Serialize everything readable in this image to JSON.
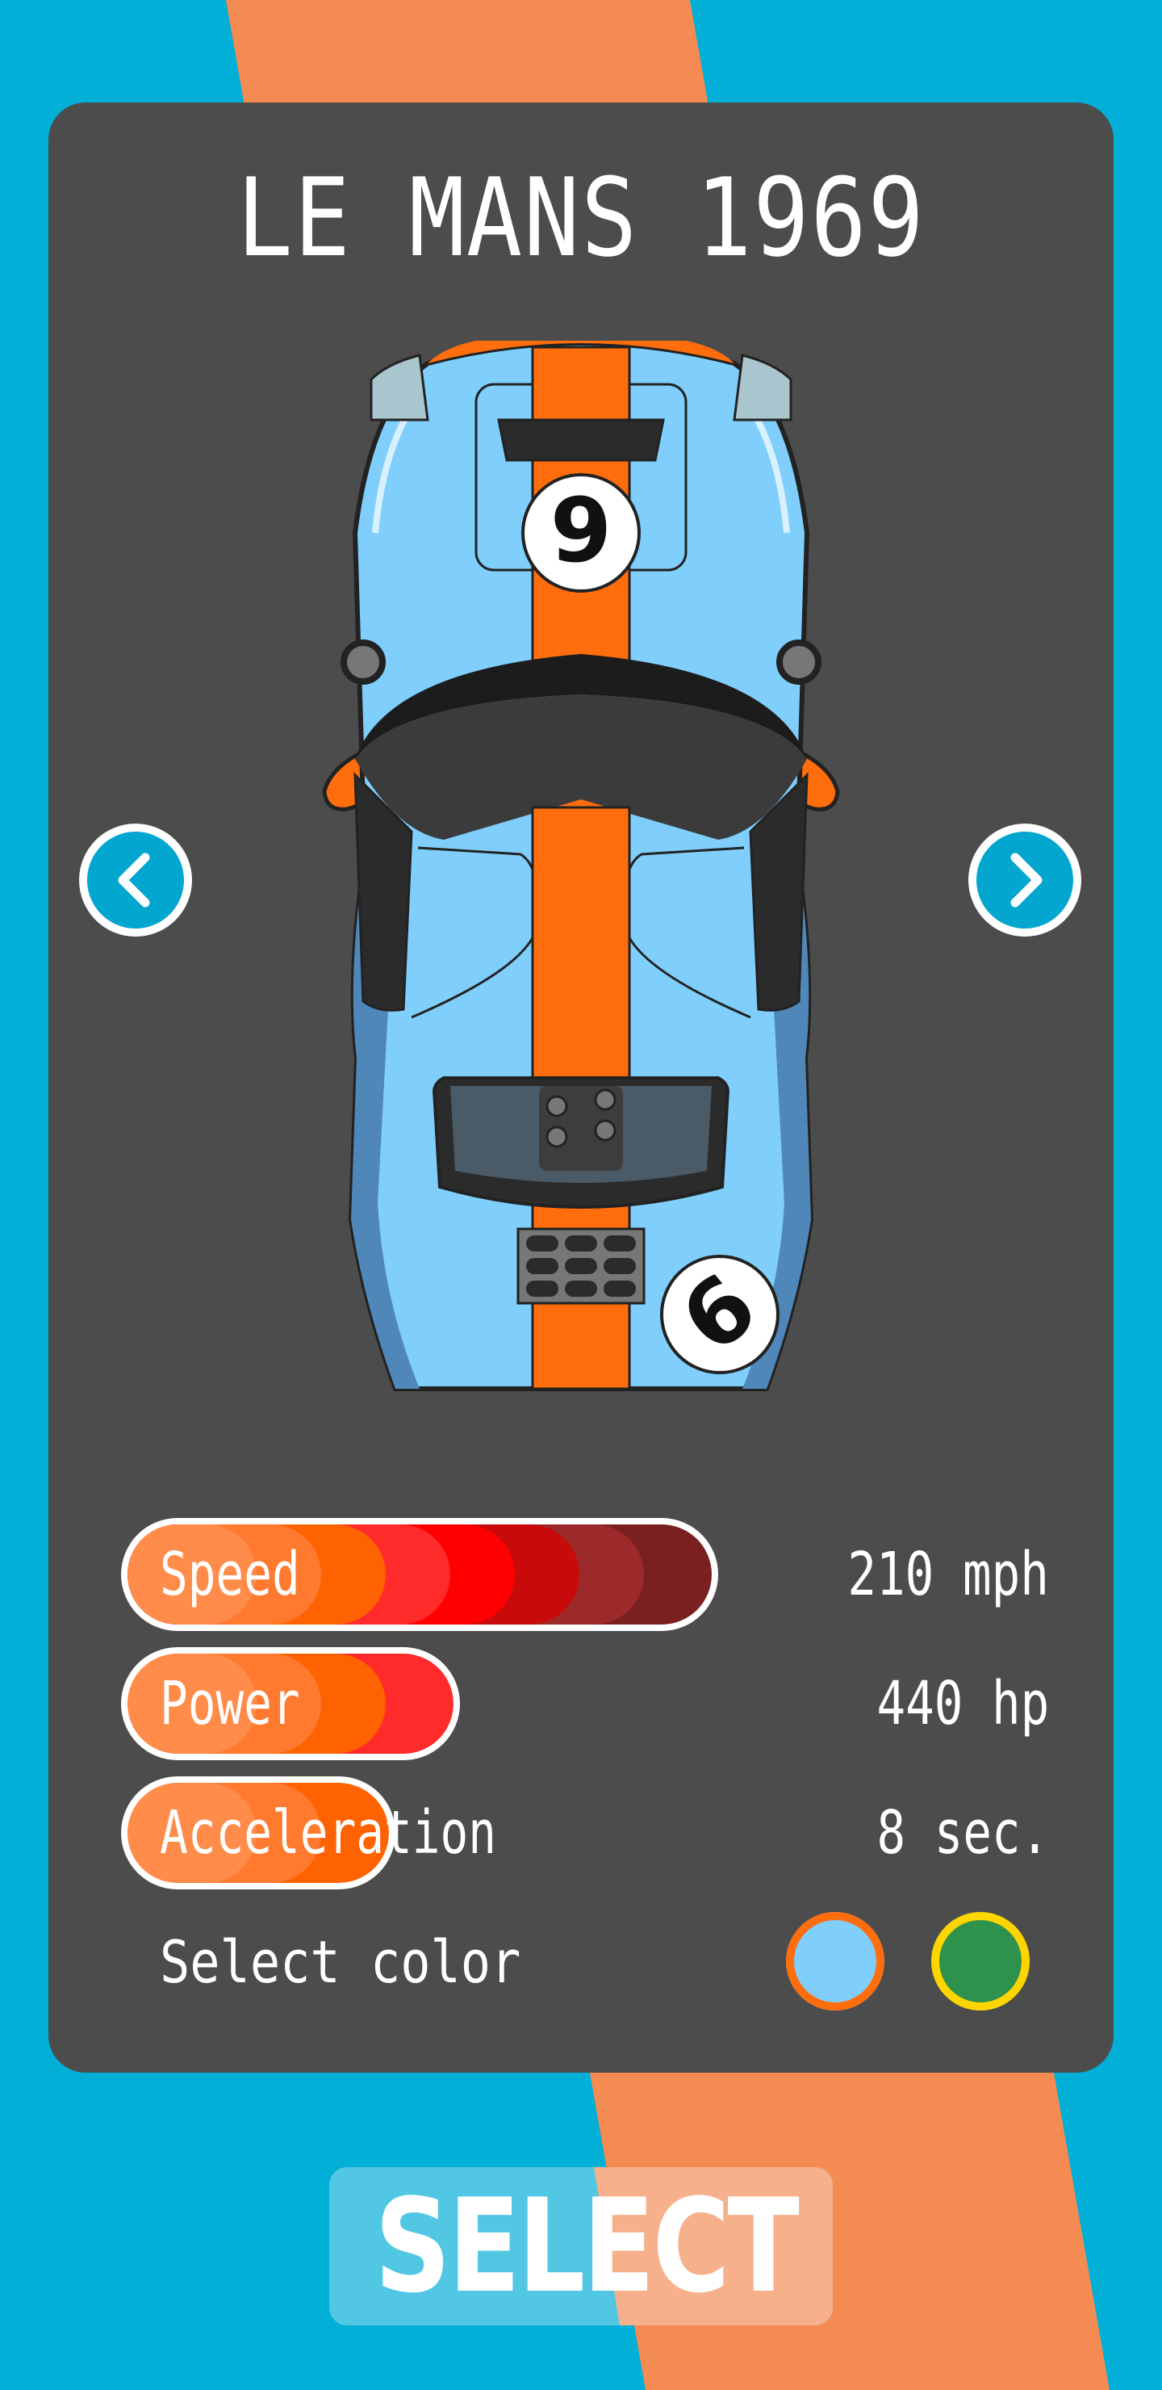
{
  "track_name": "LE MANS 1969",
  "car": {
    "livery": "gulf",
    "front_number": "9",
    "rear_number": "6",
    "colors": {
      "body": "#7fcefb",
      "stripe": "#ff6d0d",
      "shadow": "#4f87b9",
      "dark": "#2b2b2b"
    }
  },
  "navigation": {
    "prev_icon": "chevron-left-icon",
    "next_icon": "chevron-right-icon"
  },
  "stats": [
    {
      "label": "Speed",
      "value": "210 mph",
      "level": 0.82
    },
    {
      "label": "Power",
      "value": "440 hp",
      "level": 0.42
    },
    {
      "label": "Acceleration",
      "value": "8 sec.",
      "level": 0.32
    }
  ],
  "color_picker": {
    "label": "Select color",
    "options": [
      {
        "color": "#7fcefb",
        "ring": "#ff6d0d",
        "selected": true
      },
      {
        "color": "#2e914c",
        "ring": "#ffd500",
        "selected": false
      }
    ]
  },
  "select_button": {
    "label": "SELECT"
  },
  "theme": {
    "background": "#02afd6",
    "stripe": "#f38b52",
    "panel": "#4c4c4c"
  }
}
